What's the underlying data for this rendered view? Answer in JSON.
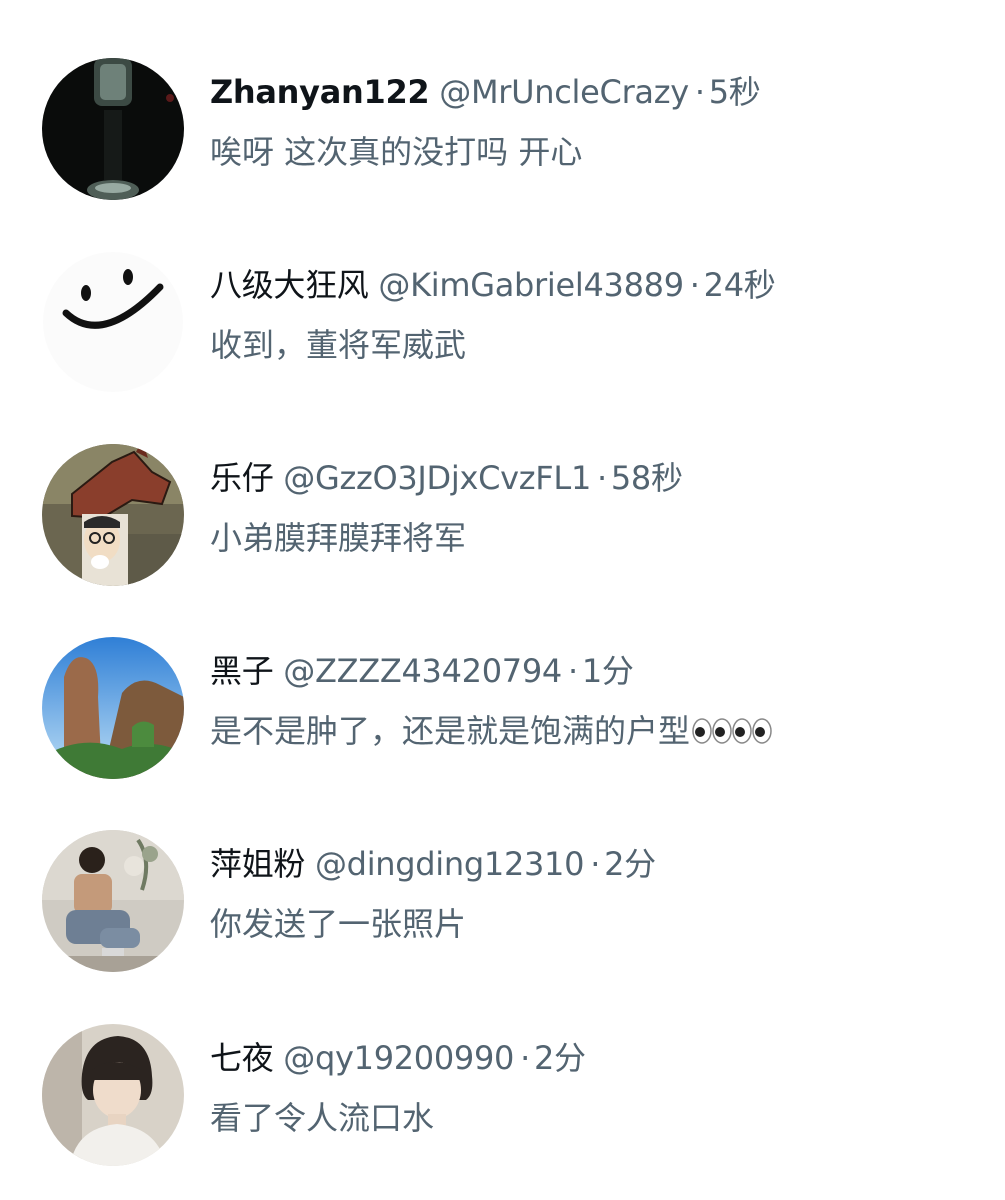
{
  "comments": [
    {
      "name": "Zhanyan122",
      "handle": "@MrUncleCrazy",
      "sep": "·",
      "time": "5秒",
      "text": "唉呀 这次真的没打吗 开心"
    },
    {
      "name": "八级大狂风",
      "handle": "@KimGabriel43889",
      "sep": "·",
      "time": "24秒",
      "text": "收到，董将军威武"
    },
    {
      "name": "乐仔",
      "handle": "@GzzO3JDjxCvzFL1",
      "sep": "·",
      "time": "58秒",
      "text": "小弟膜拜膜拜将军"
    },
    {
      "name": "黑子",
      "handle": "@ZZZZ43420794",
      "sep": "·",
      "time": "1分",
      "text": "是不是肿了，还是就是饱满的户型",
      "emoji": "eyes-emoji"
    },
    {
      "name": "萍姐粉",
      "handle": "@dingding12310",
      "sep": "·",
      "time": "2分",
      "text": "你发送了一张照片"
    },
    {
      "name": "七夜",
      "handle": "@qy19200990",
      "sep": "·",
      "time": "2分",
      "text": "看了令人流口水"
    }
  ]
}
